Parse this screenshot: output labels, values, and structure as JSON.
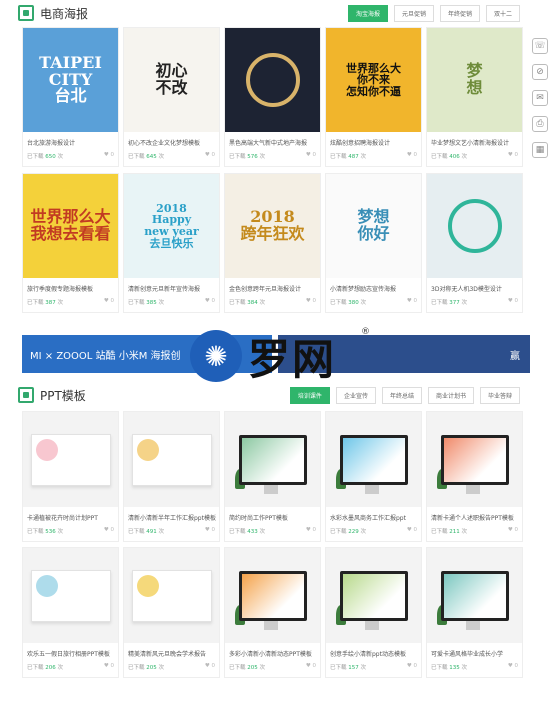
{
  "ecommerce": {
    "title": "电商海报",
    "tabs": [
      "淘宝海报",
      "元旦促销",
      "年终促销",
      "双十二"
    ],
    "cards": [
      {
        "thumb_text": "TAIPEI CITY\n台北",
        "bg": "#5aa0d8",
        "fg": "#ffffff",
        "title": "台北旅游海报设计",
        "label": "已下载",
        "count": "650",
        "unit": "次",
        "favs": "0"
      },
      {
        "thumb_text": "初心\n不改",
        "bg": "#f6f4ef",
        "fg": "#222222",
        "title": "初心不改企业文化梦想模板",
        "label": "已下载",
        "count": "645",
        "unit": "次",
        "favs": "0"
      },
      {
        "thumb_text": "",
        "bg": "#1d2333",
        "fg": "#d8b36a",
        "title": "黑色高端大气新中式地产海报",
        "label": "已下载",
        "count": "576",
        "unit": "次",
        "favs": "0"
      },
      {
        "thumb_text": "世界那么大\n你不来\n怎知你不逼",
        "bg": "#f1b52c",
        "fg": "#111111",
        "title": "炫酷创意招聘海报设计",
        "label": "已下载",
        "count": "487",
        "unit": "次",
        "favs": "0"
      },
      {
        "thumb_text": "梦\n想",
        "bg": "#dfe9c9",
        "fg": "#6e8c3a",
        "title": "毕业梦想文艺小清新海报设计",
        "label": "已下载",
        "count": "406",
        "unit": "次",
        "favs": "0"
      },
      {
        "thumb_text": "世界那么大\n我想去看看",
        "bg": "#f4d13a",
        "fg": "#c23b22",
        "title": "旅行季度假专题海报模板",
        "label": "已下载",
        "count": "387",
        "unit": "次",
        "favs": "0"
      },
      {
        "thumb_text": "2018\nHappy\nnew year\n去旦快乐",
        "bg": "#e8f4f6",
        "fg": "#2aa0c8",
        "title": "清新创意元旦新年宣传海报",
        "label": "已下载",
        "count": "385",
        "unit": "次",
        "favs": "0"
      },
      {
        "thumb_text": "2018\n跨年狂欢",
        "bg": "#f4efe4",
        "fg": "#c48a1c",
        "title": "金色创意跨年元旦海报设计",
        "label": "已下载",
        "count": "384",
        "unit": "次",
        "favs": "0"
      },
      {
        "thumb_text": "梦想\n你好",
        "bg": "#fafafa",
        "fg": "#3a8fb7",
        "title": "小清新梦想励志宣传海报",
        "label": "已下载",
        "count": "380",
        "unit": "次",
        "favs": "0"
      },
      {
        "thumb_text": "",
        "bg": "#e6eef1",
        "fg": "#2fb59a",
        "title": "3D对称无人机3D模型设计",
        "label": "已下载",
        "count": "377",
        "unit": "次",
        "favs": "0"
      }
    ]
  },
  "banner": {
    "left_text": "MI × ZOOOL 站酷  小米M  海报创",
    "right_text": "赢"
  },
  "watermark": {
    "icon": "logo-circle",
    "text": "罗网",
    "reg": "®"
  },
  "ppt": {
    "title": "PPT模板",
    "tabs": [
      "培训课件",
      "企业宣传",
      "年终总结",
      "商业计划书",
      "毕业答辩"
    ],
    "cards": [
      {
        "title": "卡通植被花卉时尚计划PPT",
        "label": "已下载",
        "count": "536",
        "unit": "次",
        "favs": "0"
      },
      {
        "title": "清新小清新半年工作汇报ppt模板",
        "label": "已下载",
        "count": "491",
        "unit": "次",
        "favs": "0"
      },
      {
        "title": "简约时尚工作PPT模板",
        "label": "已下载",
        "count": "433",
        "unit": "次",
        "favs": "0"
      },
      {
        "title": "水彩水墨风商务工作汇报ppt",
        "label": "已下载",
        "count": "229",
        "unit": "次",
        "favs": "0"
      },
      {
        "title": "清新卡通个人述职报告PPT模板",
        "label": "已下载",
        "count": "211",
        "unit": "次",
        "favs": "0"
      },
      {
        "title": "欢乐五一假日旅行相册PPT模板",
        "label": "已下载",
        "count": "206",
        "unit": "次",
        "favs": "0"
      },
      {
        "title": "精美清新风元旦晚会学术报告",
        "label": "已下载",
        "count": "205",
        "unit": "次",
        "favs": "0"
      },
      {
        "title": "多彩小清新小清新动态PPT模板",
        "label": "已下载",
        "count": "205",
        "unit": "次",
        "favs": "0"
      },
      {
        "title": "创意手绘小清新ppt动态模板",
        "label": "已下载",
        "count": "157",
        "unit": "次",
        "favs": "0"
      },
      {
        "title": "可爱卡通风格毕业成长小学",
        "label": "已下载",
        "count": "135",
        "unit": "次",
        "favs": "0"
      }
    ]
  },
  "side_tools": [
    {
      "name": "service-icon",
      "glyph": "☏"
    },
    {
      "name": "compass-icon",
      "glyph": "⊘"
    },
    {
      "name": "message-icon",
      "glyph": "✉"
    },
    {
      "name": "print-icon",
      "glyph": "⎙"
    },
    {
      "name": "qr-icon",
      "glyph": "▦"
    }
  ]
}
